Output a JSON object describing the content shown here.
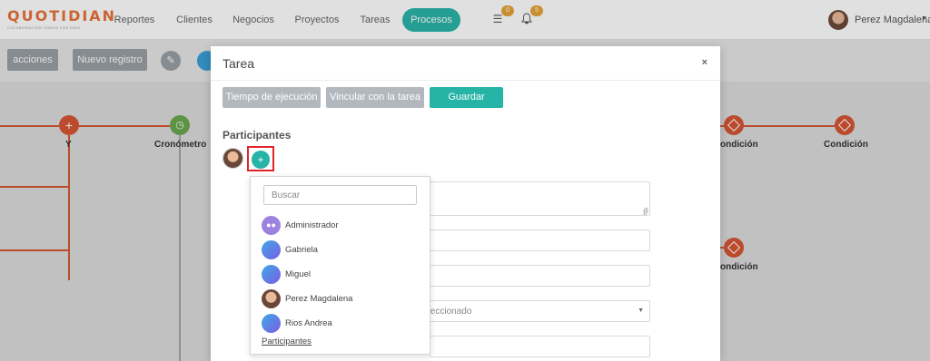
{
  "app": {
    "logo_text": "QUOTIDIAN",
    "logo_tagline": "COLABORACIÓN TODOS LOS DÍAS"
  },
  "nav": {
    "items": [
      {
        "label": "Reportes"
      },
      {
        "label": "Clientes"
      },
      {
        "label": "Negocios"
      },
      {
        "label": "Proyectos"
      },
      {
        "label": "Tareas"
      },
      {
        "label": "Procesos",
        "active": true
      }
    ],
    "tasks_badge": "0",
    "notifications_badge": "5",
    "user_name": "Perez Magdalena",
    "accent_color": "#2bb5a8"
  },
  "toolbar": {
    "acciones_label": "acciones",
    "nuevo_registro_label": "Nuevo registro",
    "edit_icon": "pencil-icon"
  },
  "workflow": {
    "nodes": [
      {
        "label": "Y",
        "icon": "plus-icon"
      },
      {
        "label": "Cronómetro",
        "icon": "clock-icon"
      },
      {
        "label": "ondición",
        "icon": "diamond-icon"
      },
      {
        "label": "Condición",
        "icon": "diamond-icon"
      },
      {
        "label": "ondición",
        "icon": "diamond-icon"
      }
    ],
    "node_color": "#d65634"
  },
  "modal": {
    "title": "Tarea",
    "close_label": "×",
    "buttons": {
      "tiempo": "Tiempo de ejecución",
      "vincular": "Vincular con la tarea",
      "guardar": "Guardar"
    },
    "participants_title": "Participantes",
    "add_label": "+",
    "select_value": "eleccionado"
  },
  "dropdown": {
    "search_placeholder": "Buscar",
    "items": [
      {
        "name": "Administrador",
        "avatar": "group-icon"
      },
      {
        "name": "Gabriela",
        "avatar": "gradient-avatar"
      },
      {
        "name": "Miguel",
        "avatar": "gradient-avatar"
      },
      {
        "name": "Perez Magdalena",
        "avatar": "photo-avatar"
      },
      {
        "name": "Rios Andrea",
        "avatar": "gradient-avatar"
      }
    ],
    "footer_link": "Participantes"
  }
}
